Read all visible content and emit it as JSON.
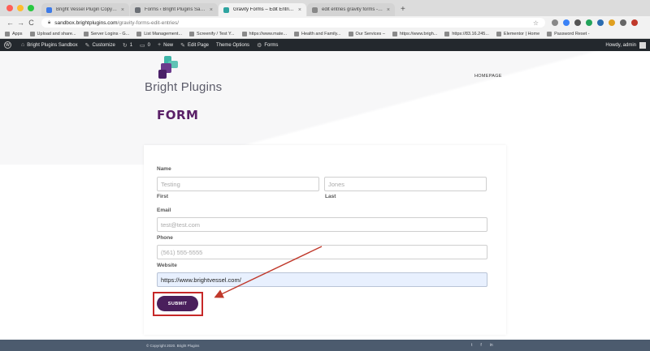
{
  "browser": {
    "tabs": [
      {
        "label": "Bright Vessel Plugin Copy - Go",
        "favicon_color": "#3c7ae8",
        "active": false
      },
      {
        "label": "Forms ‹ Bright Plugins Sandbo",
        "favicon_color": "#6b6f75",
        "active": false
      },
      {
        "label": "Gravity Forms – Edit Entries -",
        "favicon_color": "#2ea4a0",
        "active": true
      },
      {
        "label": "edit entries gravity forms - Go",
        "favicon_color": "#888888",
        "active": false
      }
    ],
    "tab_close": "×",
    "new_tab": "+",
    "url_host": "sandbox.brightplugins.com",
    "url_path": "/gravity-forms-edit-entries/",
    "back": "←",
    "forward": "→",
    "reload": "C",
    "star": "☆",
    "extension_colors": [
      "#888888",
      "#3b82f6",
      "#555555",
      "#22a35a",
      "#2b6cb0",
      "#e0a020",
      "#666666",
      "#c0392b"
    ],
    "bookmarks": [
      "Apps",
      "Upload and share...",
      "Server Logins - G...",
      "List Management...",
      "Screenify / Test Y...",
      "https://www.mate...",
      "Health and Family...",
      "Our Services –",
      "https://www.brigh...",
      "https://83.16.245...",
      "Elementor | Home",
      "Password Reset -"
    ]
  },
  "adminbar": {
    "wp_logo": "W",
    "site_name": "Bright Plugins Sandbox",
    "customize": "Customize",
    "updates_count": "1",
    "comments_count": "0",
    "new": "New",
    "edit_page": "Edit Page",
    "theme_options": "Theme Options",
    "forms": "Forms",
    "howdy": "Howdy, admin"
  },
  "site": {
    "logo_text": "Bright Plugins",
    "homepage_link": "HOMEPAGE",
    "page_title": "FORM"
  },
  "form": {
    "name_label": "Name",
    "first_value": "Testing",
    "first_sublabel": "First",
    "last_value": "Jones",
    "last_sublabel": "Last",
    "email_label": "Email",
    "email_value": "test@test.com",
    "phone_label": "Phone",
    "phone_value": "(561) 555-5555",
    "website_label": "Website",
    "website_value": "https://www.brightvessel.com/",
    "submit_label": "SUBMIT"
  },
  "footer": {
    "copyright": "© Copyright 2020. Bright Plugins",
    "social": [
      "t",
      "f",
      "in"
    ]
  },
  "colors": {
    "brand_purple": "#5a2067",
    "submit_bg": "#4a1f5c",
    "highlight_red": "#c62828",
    "adminbar_bg": "#23282d",
    "footer_bg": "#4c5b6e",
    "autofill_bg": "#e8f0fe"
  }
}
